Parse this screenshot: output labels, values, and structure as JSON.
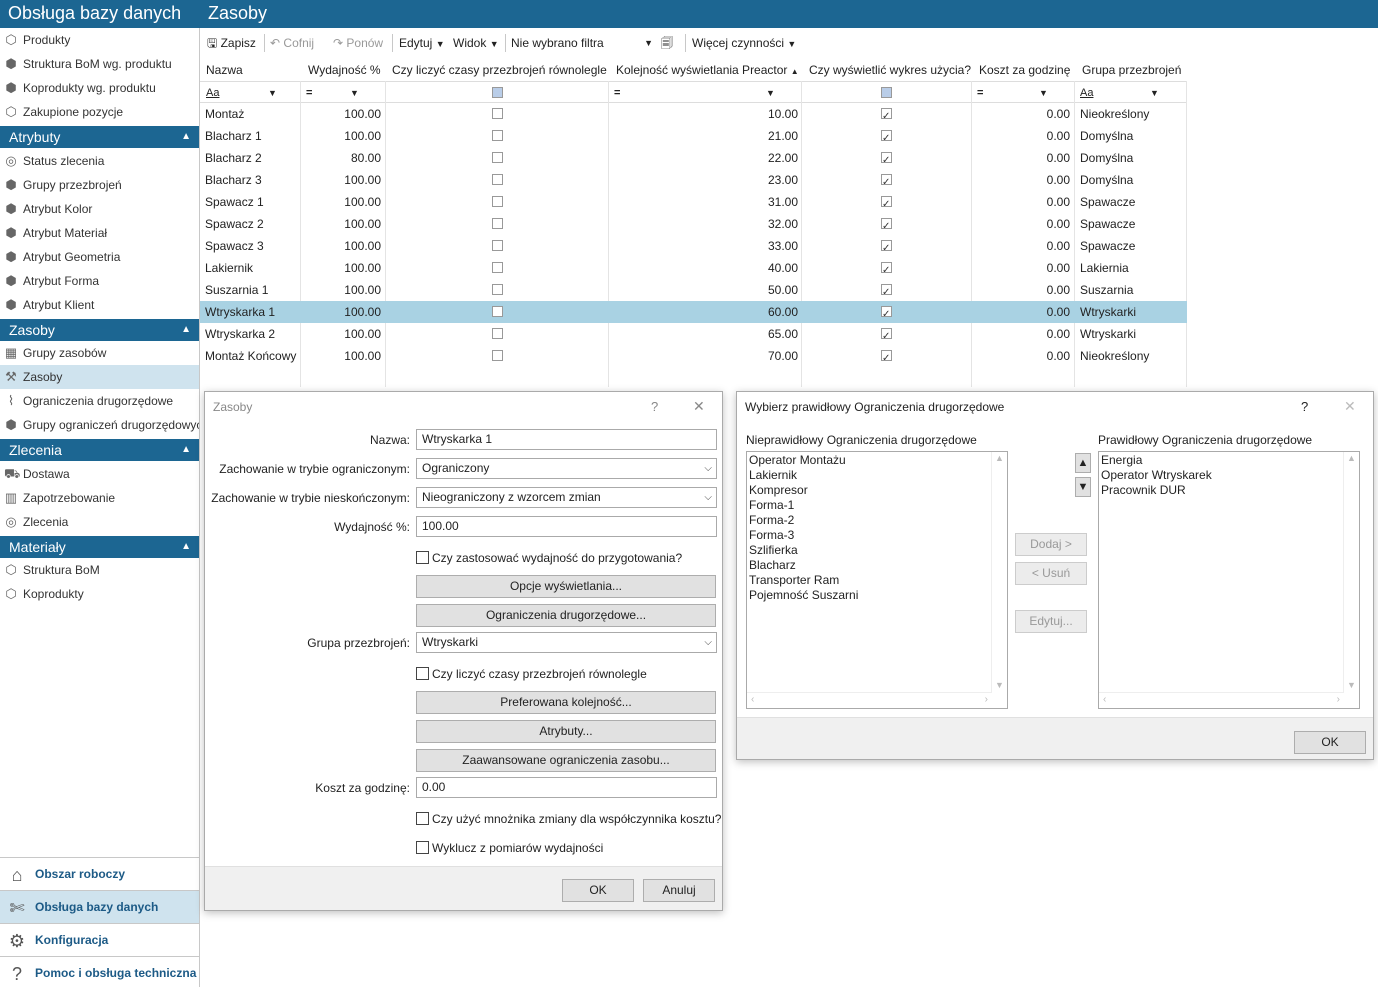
{
  "titlebar": {
    "app": "Obsługa bazy danych",
    "page": "Zasoby"
  },
  "sidebar": {
    "top_items": [
      {
        "label": "Produkty",
        "icon": "cube-icon"
      },
      {
        "label": "Struktura BoM wg. produktu",
        "icon": "cubes-icon"
      },
      {
        "label": "Koprodukty wg. produktu",
        "icon": "cubes-icon"
      },
      {
        "label": "Zakupione pozycje",
        "icon": "cube-icon"
      }
    ],
    "sections": [
      {
        "title": "Atrybuty",
        "items": [
          "Status zlecenia",
          "Grupy przezbrojeń",
          "Atrybut Kolor",
          "Atrybut Materiał",
          "Atrybut Geometria",
          "Atrybut Forma",
          "Atrybut Klient"
        ]
      },
      {
        "title": "Zasoby",
        "items": [
          "Grupy zasobów",
          "Zasoby",
          "Ograniczenia drugorzędowe",
          "Grupy ograniczeń drugorzędowych"
        ]
      },
      {
        "title": "Zlecenia",
        "items": [
          "Dostawa",
          "Zapotrzebowanie",
          "Zlecenia"
        ]
      },
      {
        "title": "Materiały",
        "items": [
          "Struktura BoM",
          "Koprodukty"
        ]
      }
    ],
    "bottom": [
      "Obszar roboczy",
      "Obsługa bazy danych",
      "Konfiguracja",
      "Pomoc i obsługa techniczna"
    ]
  },
  "toolbar": {
    "save": "Zapisz",
    "undo": "Cofnij",
    "redo": "Ponów",
    "edit": "Edytuj",
    "view": "Widok",
    "filter": "Nie wybrano filtra",
    "more": "Więcej czynności"
  },
  "grid": {
    "headers": [
      "Nazwa",
      "Wydajność %",
      "Czy liczyć czasy przezbrojeń równolegle",
      "Kolejność wyświetlania Preactor",
      "Czy wyświetlić wykres użycia?",
      "Koszt za godzinę",
      "Grupa przezbrojeń"
    ],
    "filters": {
      "text": "Aa",
      "eq": "="
    },
    "rows": [
      {
        "name": "Montaż",
        "eff": "100.00",
        "par": false,
        "order": "10.00",
        "chart": true,
        "cost": "0.00",
        "group": "Nieokreślony"
      },
      {
        "name": "Blacharz 1",
        "eff": "100.00",
        "par": false,
        "order": "21.00",
        "chart": true,
        "cost": "0.00",
        "group": "Domyślna"
      },
      {
        "name": "Blacharz 2",
        "eff": "80.00",
        "par": false,
        "order": "22.00",
        "chart": true,
        "cost": "0.00",
        "group": "Domyślna"
      },
      {
        "name": "Blacharz 3",
        "eff": "100.00",
        "par": false,
        "order": "23.00",
        "chart": true,
        "cost": "0.00",
        "group": "Domyślna"
      },
      {
        "name": "Spawacz 1",
        "eff": "100.00",
        "par": false,
        "order": "31.00",
        "chart": true,
        "cost": "0.00",
        "group": "Spawacze"
      },
      {
        "name": "Spawacz 2",
        "eff": "100.00",
        "par": false,
        "order": "32.00",
        "chart": true,
        "cost": "0.00",
        "group": "Spawacze"
      },
      {
        "name": "Spawacz 3",
        "eff": "100.00",
        "par": false,
        "order": "33.00",
        "chart": true,
        "cost": "0.00",
        "group": "Spawacze"
      },
      {
        "name": "Lakiernik",
        "eff": "100.00",
        "par": false,
        "order": "40.00",
        "chart": true,
        "cost": "0.00",
        "group": "Lakiernia"
      },
      {
        "name": "Suszarnia 1",
        "eff": "100.00",
        "par": false,
        "order": "50.00",
        "chart": true,
        "cost": "0.00",
        "group": "Suszarnia"
      },
      {
        "name": "Wtryskarka 1",
        "eff": "100.00",
        "par": false,
        "order": "60.00",
        "chart": true,
        "cost": "0.00",
        "group": "Wtryskarki",
        "selected": true
      },
      {
        "name": "Wtryskarka 2",
        "eff": "100.00",
        "par": false,
        "order": "65.00",
        "chart": true,
        "cost": "0.00",
        "group": "Wtryskarki"
      },
      {
        "name": "Montaż Końcowy",
        "eff": "100.00",
        "par": false,
        "order": "70.00",
        "chart": true,
        "cost": "0.00",
        "group": "Nieokreślony"
      }
    ]
  },
  "dialog1": {
    "title": "Zasoby",
    "help": "?",
    "close": "✕",
    "name_label": "Nazwa:",
    "name_value": "Wtryskarka 1",
    "finite_label": "Zachowanie w trybie ograniczonym:",
    "finite_value": "Ograniczony",
    "infinite_label": "Zachowanie w trybie nieskończonym:",
    "infinite_value": "Nieograniczony z wzorcem zmian",
    "eff_label": "Wydajność %:",
    "eff_value": "100.00",
    "cb_eff_setup": "Czy zastosować wydajność do przygotowania?",
    "btn_display": "Opcje wyświetlania...",
    "btn_constraints": "Ograniczenia drugorzędowe...",
    "group_label": "Grupa przezbrojeń:",
    "group_value": "Wtryskarki",
    "cb_parallel": "Czy liczyć czasy przezbrojeń równolegle",
    "btn_pref": "Preferowana kolejność...",
    "btn_attr": "Atrybuty...",
    "btn_adv": "Zaawansowane ograniczenia zasobu...",
    "cost_label": "Koszt za godzinę:",
    "cost_value": "0.00",
    "cb_multiplier": "Czy użyć mnożnika zmiany dla współczynnika kosztu?",
    "cb_exclude": "Wyklucz z pomiarów wydajności",
    "ok": "OK",
    "cancel": "Anuluj"
  },
  "dialog2": {
    "title": "Wybierz prawidłowy Ograniczenia drugorzędowe",
    "help": "?",
    "close": "✕",
    "left_title": "Nieprawidłowy Ograniczenia drugorzędowe",
    "right_title": "Prawidłowy Ograniczenia drugorzędowe",
    "left_items": [
      "Operator Montażu",
      "Lakiernik",
      "Kompresor",
      "Forma-1",
      "Forma-2",
      "Forma-3",
      "Szlifierka",
      "Blacharz",
      "Transporter Ram",
      "Pojemność Suszarni"
    ],
    "right_items": [
      "Energia",
      "Operator Wtryskarek",
      "Pracownik DUR"
    ],
    "add": "Dodaj >",
    "remove": "< Usuń",
    "edit": "Edytuj...",
    "ok": "OK"
  }
}
